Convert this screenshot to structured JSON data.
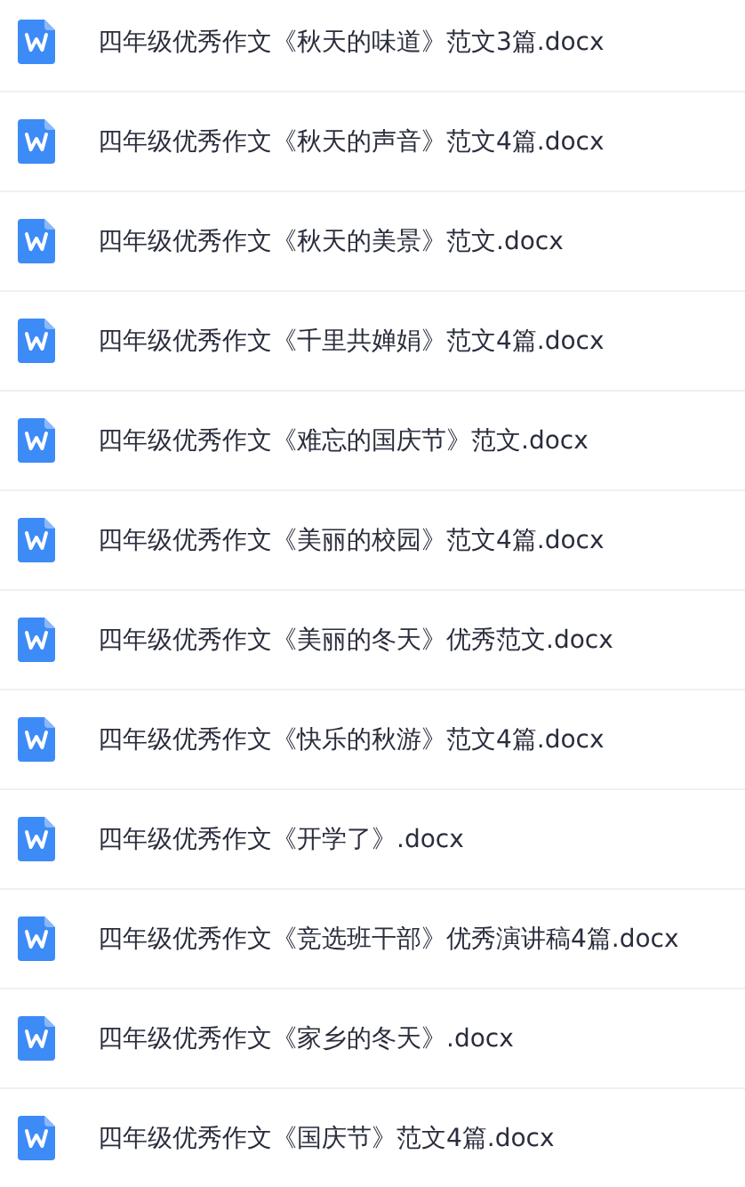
{
  "files": [
    {
      "name": "四年级优秀作文《秋天的味道》范文3篇.docx"
    },
    {
      "name": "四年级优秀作文《秋天的声音》范文4篇.docx"
    },
    {
      "name": "四年级优秀作文《秋天的美景》范文.docx"
    },
    {
      "name": "四年级优秀作文《千里共婵娟》范文4篇.docx"
    },
    {
      "name": "四年级优秀作文《难忘的国庆节》范文.docx"
    },
    {
      "name": "四年级优秀作文《美丽的校园》范文4篇.docx"
    },
    {
      "name": "四年级优秀作文《美丽的冬天》优秀范文.docx"
    },
    {
      "name": "四年级优秀作文《快乐的秋游》范文4篇.docx"
    },
    {
      "name": "四年级优秀作文《开学了》.docx"
    },
    {
      "name": "四年级优秀作文《竞选班干部》优秀演讲稿4篇.docx"
    },
    {
      "name": "四年级优秀作文《家乡的冬天》.docx"
    },
    {
      "name": "四年级优秀作文《国庆节》范文4篇.docx"
    }
  ]
}
